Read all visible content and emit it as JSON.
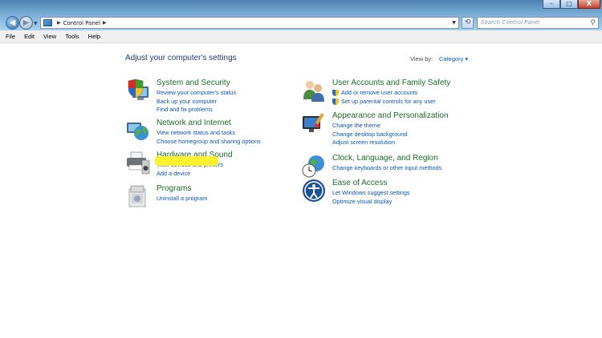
{
  "window": {
    "buttons": {
      "minimize": "–",
      "maximize": "□",
      "close": "X"
    }
  },
  "navigation": {
    "back_glyph": "◀",
    "forward_glyph": "▶",
    "address": {
      "breadcrumb": "Control Panel"
    },
    "refresh_glyph": "⟲",
    "search": {
      "placeholder": "Search Control Panel"
    }
  },
  "menu": [
    "File",
    "Edit",
    "View",
    "Tools",
    "Help"
  ],
  "main": {
    "heading": "Adjust your computer's settings",
    "view_by_label": "View by:",
    "view_by_value": "Category"
  },
  "categories": {
    "system_security": {
      "title": "System and Security",
      "icon": "shield-computer-icon",
      "links": [
        "Review your computer's status",
        "Back up your computer",
        "Find and fix problems"
      ]
    },
    "network_internet": {
      "title": "Network and Internet",
      "icon": "globe-network-icon",
      "links": [
        "View network status and tasks",
        "Choose homegroup and sharing options"
      ]
    },
    "hardware_sound": {
      "title": "Hardware and Sound",
      "icon": "printer-speaker-icon",
      "links": [
        "View devices and printers",
        "Add a device"
      ]
    },
    "programs": {
      "title": "Programs",
      "icon": "programs-box-icon",
      "links": [
        "Uninstall a program"
      ]
    },
    "user_accounts": {
      "title": "User Accounts and Family Safety",
      "icon": "users-icon",
      "links": [
        "Add or remove user accounts",
        "Set up parental controls for any user"
      ]
    },
    "appearance": {
      "title": "Appearance and Personalization",
      "icon": "monitor-paint-icon",
      "links": [
        "Change the theme",
        "Change desktop background",
        "Adjust screen resolution"
      ]
    },
    "clock_language": {
      "title": "Clock, Language, and Region",
      "icon": "clock-globe-icon",
      "links": [
        "Change keyboards or other input methods"
      ]
    },
    "ease_of_access": {
      "title": "Ease of Access",
      "icon": "accessibility-icon",
      "links": [
        "Let Windows suggest settings",
        "Optimize visual display"
      ]
    }
  },
  "colors": {
    "category_title": "#1b6d2c",
    "link": "#0b55b0",
    "highlight": "#fff22c",
    "heading": "#1e3b6e"
  }
}
